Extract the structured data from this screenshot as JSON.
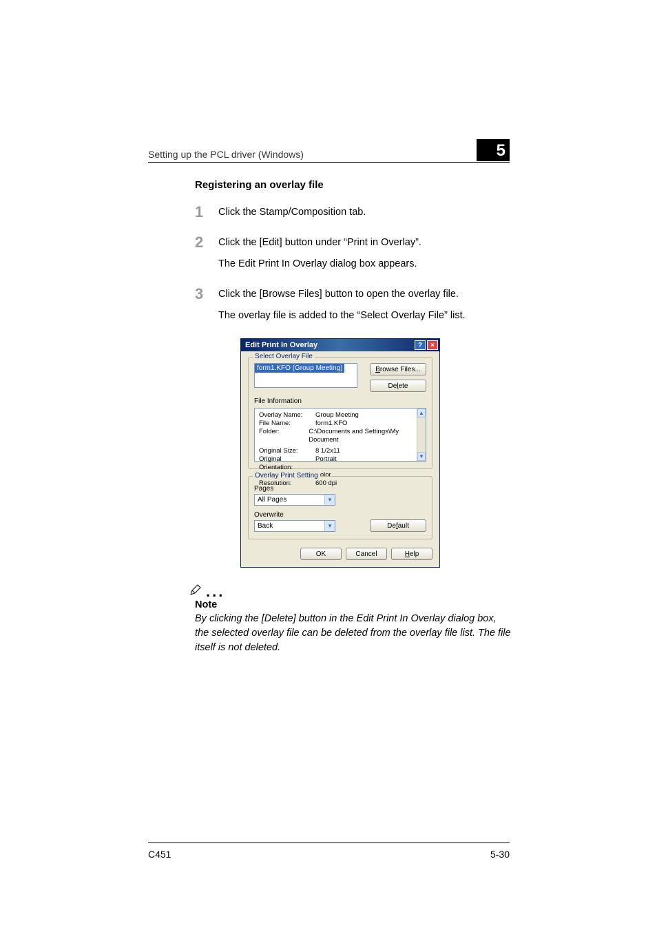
{
  "header": {
    "running": "Setting up the PCL driver (Windows)",
    "chapter": "5"
  },
  "section_title": "Registering an overlay file",
  "steps": [
    {
      "num": "1",
      "lines": [
        "Click the Stamp/Composition tab."
      ]
    },
    {
      "num": "2",
      "lines": [
        "Click the [Edit] button under “Print in Overlay”.",
        "The Edit Print In Overlay dialog box appears."
      ]
    },
    {
      "num": "3",
      "lines": [
        "Click the [Browse Files] button to open the overlay file.",
        "The overlay file is added to the “Select Overlay File” list."
      ]
    }
  ],
  "dialog": {
    "title": "Edit Print In Overlay",
    "group_select": {
      "legend": "Select Overlay File",
      "selected_item": "form1.KFO (Group Meeting)",
      "browse_btn": "Browse Files...",
      "browse_underline": "B",
      "delete_btn": "Delete",
      "delete_underline": "l",
      "file_info_label": "File Information",
      "info": {
        "overlay_name_k": "Overlay Name:",
        "overlay_name_v": "Group Meeting",
        "file_name_k": "File Name:",
        "file_name_v": "form1.KFO",
        "folder_k": "Folder:",
        "folder_v": "C:\\Documents and Settings\\My Document",
        "orig_size_k": "Original Size:",
        "orig_size_v": "8 1/2x11",
        "orient_k": "Original Orientation:",
        "orient_v": "Portrait",
        "color_k": "Color:",
        "color_v": "Color",
        "res_k": "Resolution:",
        "res_v": "600 dpi"
      }
    },
    "group_print": {
      "legend": "Overlay Print Setting",
      "pages_label": "Pages",
      "pages_value": "All Pages",
      "overwrite_label": "Overwrite",
      "overwrite_value": "Back",
      "default_btn": "Default",
      "default_underline": "f"
    },
    "footer": {
      "ok": "OK",
      "cancel": "Cancel",
      "help": "Help",
      "help_underline": "H"
    }
  },
  "note": {
    "title": "Note",
    "body": "By clicking the [Delete] button in the Edit Print In Overlay dialog box, the selected overlay file can be deleted from the overlay file list. The file itself is not deleted."
  },
  "footer": {
    "left": "C451",
    "right": "5-30"
  }
}
